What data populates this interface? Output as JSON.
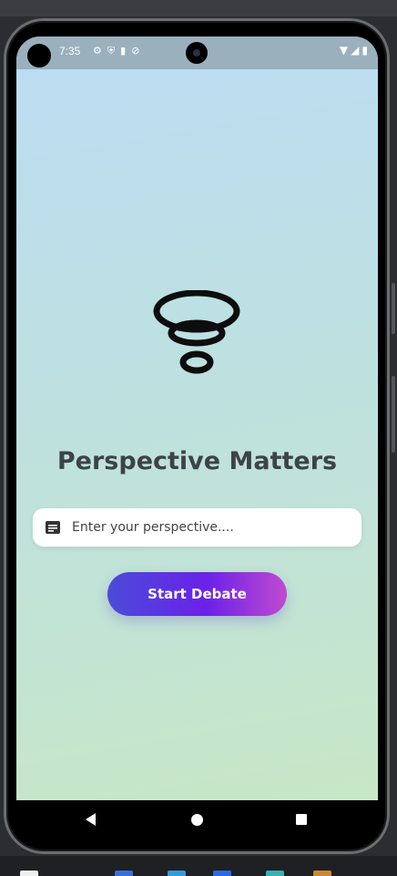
{
  "status_bar": {
    "time": "7:35",
    "left_icons": [
      "gear-icon",
      "shield-icon",
      "sd-card-icon",
      "location-icon"
    ],
    "right_icons": [
      "wifi-icon",
      "signal-icon",
      "battery-icon"
    ]
  },
  "main": {
    "logo": "tornado-logo",
    "title": "Perspective Matters",
    "input": {
      "placeholder": "Enter your perspective....",
      "value": "",
      "icon": "subject-icon"
    },
    "start_button_label": "Start Debate"
  },
  "nav_bar": {
    "items": [
      "back-icon",
      "home-icon",
      "recents-icon"
    ]
  },
  "colors": {
    "title": "#3d4348",
    "button_gradient_start": "#4a4cd9",
    "button_gradient_end": "#c04ad0"
  }
}
